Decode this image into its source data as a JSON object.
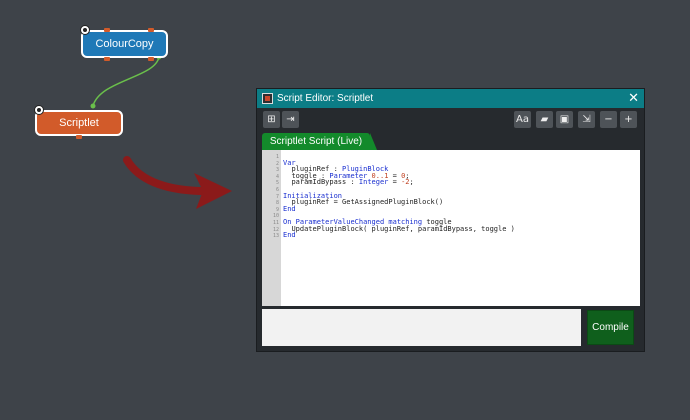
{
  "graph": {
    "nodes": [
      {
        "label": "ColourCopy"
      },
      {
        "label": "Scriptlet"
      }
    ]
  },
  "editor": {
    "title": "Script Editor: Scriptlet",
    "tab_label": "Scriptlet Script (Live)",
    "compile_label": "Compile",
    "close_glyph": "✕",
    "toolbar_left": [
      "bracket-icon",
      "exit-icon"
    ],
    "toolbar_right": [
      "font-icon",
      "folder-icon",
      "save-icon",
      "import-icon",
      "minus-icon",
      "plus-icon"
    ],
    "code_lines": [
      "",
      "Var",
      "  pluginRef : PluginBlock",
      "  toggle : Parameter 0..1 = 0;",
      "  paramIdBypass : Integer = -2;",
      "",
      "Initialization",
      "  pluginRef = GetAssignedPluginBlock()",
      "End",
      "",
      "On ParameterValueChanged matching toggle",
      "  UpdatePluginBlock( pluginRef, paramIdBypass, toggle )",
      "End"
    ],
    "line_numbers": [
      "1",
      "2",
      "3",
      "4",
      "5",
      "6",
      "7",
      "8",
      "9",
      "10",
      "11",
      "12",
      "13"
    ]
  },
  "colors": {
    "background": "#3e4349",
    "colourcopy_node": "#1f79b7",
    "scriptlet_node": "#d25b2a",
    "titlebar": "#0c7d86",
    "tab": "#138a2b",
    "compile": "#0f5f1c",
    "arrow": "#8b1a1a"
  }
}
